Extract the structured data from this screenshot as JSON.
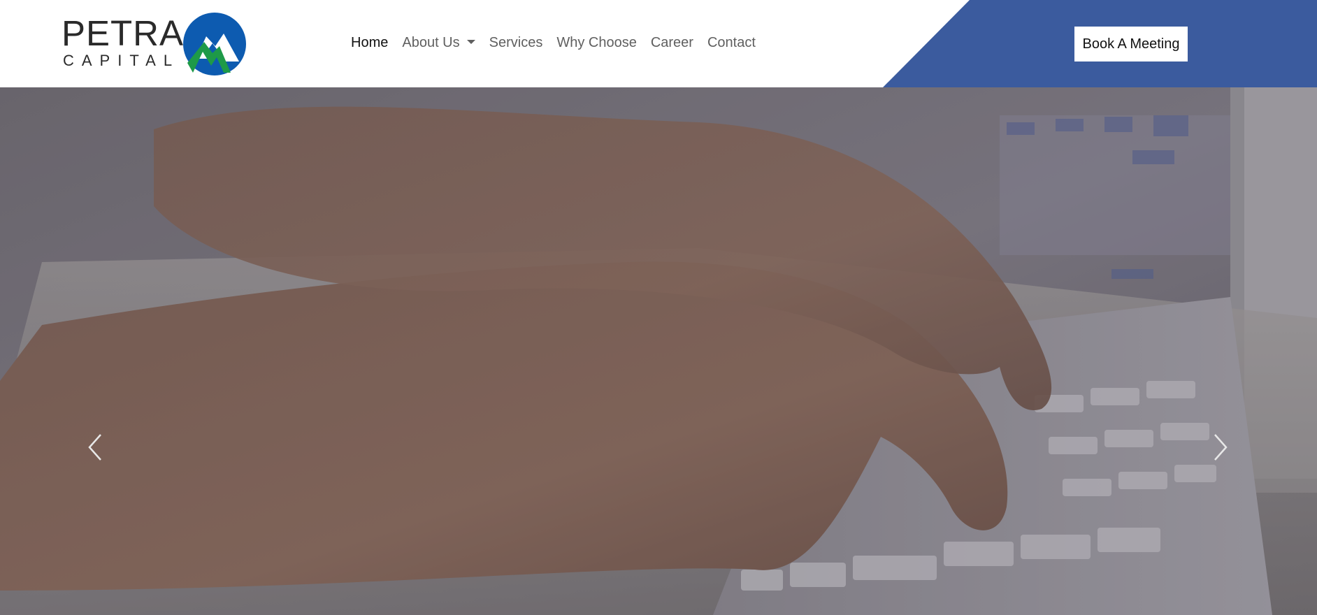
{
  "brand": {
    "name": "PETRA",
    "tagline": "CAPITAL"
  },
  "nav": {
    "items": [
      {
        "label": "Home",
        "active": true
      },
      {
        "label": "About Us",
        "dropdown": true
      },
      {
        "label": "Services"
      },
      {
        "label": "Why Choose"
      },
      {
        "label": "Career"
      },
      {
        "label": "Contact"
      }
    ],
    "cta_label": "Book A Meeting"
  },
  "colors": {
    "accent_blue": "#3b5b9e",
    "logo_blue": "#0d5bb0",
    "logo_green": "#1e9a48"
  },
  "hero": {
    "image": "hands-typing-on-keyboard",
    "controls": [
      "chevron-left-icon",
      "chevron-right-icon"
    ]
  }
}
